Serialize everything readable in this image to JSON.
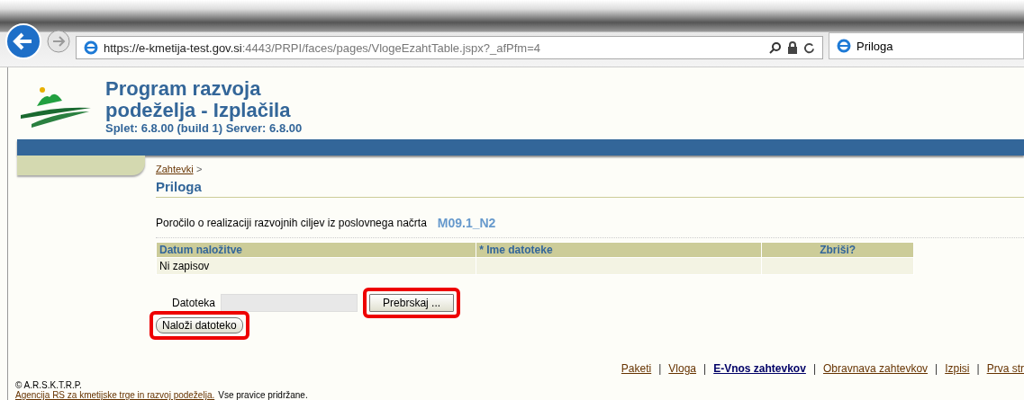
{
  "browser": {
    "url_host": "https://e-kmetija-test.gov.si",
    "url_rest": ":4443/PRPI/faces/pages/VlogeEzahtTable.jspx?_afPfm=4",
    "tab_title": "Priloga"
  },
  "header": {
    "title_lines": [
      "Program razvoja",
      "podeželja - Izplačila"
    ],
    "version": "Splet: 6.8.00 (build 1) Server: 6.8.00"
  },
  "breadcrumb": {
    "link": "Zahtevki",
    "separator": ">"
  },
  "page_title": "Priloga",
  "report": {
    "label": "Poročilo o realizaciji razvojnih ciljev iz poslovnega načrta",
    "code": "M09.1_N2"
  },
  "table": {
    "columns": [
      {
        "label": "Datum naložitve"
      },
      {
        "label": "Ime datoteke",
        "marker": "*"
      },
      {
        "label": "Zbriši?"
      }
    ],
    "rows": [
      [
        "Ni zapisov",
        "",
        ""
      ]
    ]
  },
  "upload": {
    "label": "Datoteka",
    "browse_button": {
      "label": "Prebrskaj ...",
      "highlighted": true
    },
    "upload_button": {
      "label": "Naloži datoteko",
      "highlighted": true
    }
  },
  "footer": {
    "separator": "|",
    "nav": [
      {
        "label": "Paketi",
        "selected": false
      },
      {
        "label": "Vloga",
        "selected": false
      },
      {
        "label": "E-Vnos zahtevkov",
        "selected": true
      },
      {
        "label": "Obravnava zahtevkov",
        "selected": false
      },
      {
        "label": "Izpisi",
        "selected": false
      },
      {
        "label": "Prva str",
        "selected": false
      }
    ],
    "copyright": "© A.R.S.K.T.R.P.",
    "agency_link": "Agencija RS za kmetijske trge in razvoj podeželja.",
    "rights": "Vse pravice pridržane."
  }
}
